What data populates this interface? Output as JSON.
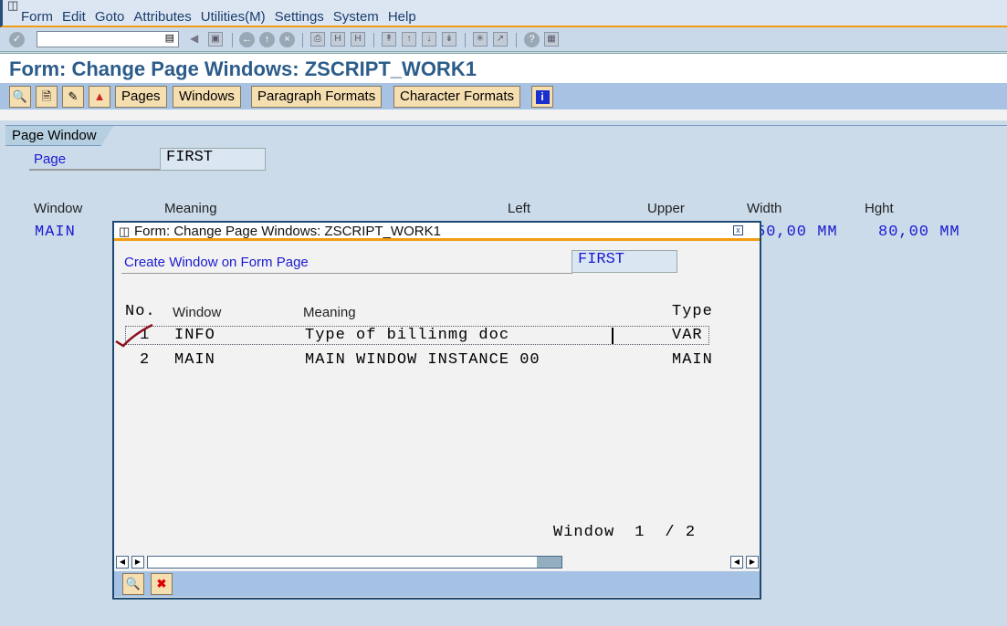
{
  "menu": {
    "items": [
      "Form",
      "Edit",
      "Goto",
      "Attributes",
      "Utilities(M)",
      "Settings",
      "System",
      "Help"
    ]
  },
  "toolbar": {
    "command_field_value": ""
  },
  "header": {
    "title": "Form: Change Page Windows: ZSCRIPT_WORK1"
  },
  "app_toolbar": {
    "pages": "Pages",
    "windows": "Windows",
    "paragraph_formats": "Paragraph Formats",
    "character_formats": "Character Formats"
  },
  "main": {
    "tab": "Page Window",
    "page_label": "Page",
    "page_value": "FIRST",
    "columns": [
      "Window",
      "Meaning",
      "Left",
      "Upper",
      "Width",
      "Hght"
    ],
    "row": {
      "window": "MAIN",
      "width": "50,00 MM",
      "height": "80,00 MM"
    }
  },
  "dialog": {
    "title": "Form: Change Page Windows: ZSCRIPT_WORK1",
    "label": "Create Window on Form Page",
    "page_value": "FIRST",
    "columns": {
      "no": "No.",
      "window": "Window",
      "meaning": "Meaning",
      "type": "Type"
    },
    "rows": [
      {
        "no": "1",
        "window": "INFO",
        "meaning": "Type of billinmg doc",
        "type": "VAR"
      },
      {
        "no": "2",
        "window": "MAIN",
        "meaning": "MAIN WINDOW INSTANCE 00",
        "type": "MAIN"
      }
    ],
    "pager": {
      "label": "Window",
      "current": "1",
      "total": "/ 2"
    }
  }
}
